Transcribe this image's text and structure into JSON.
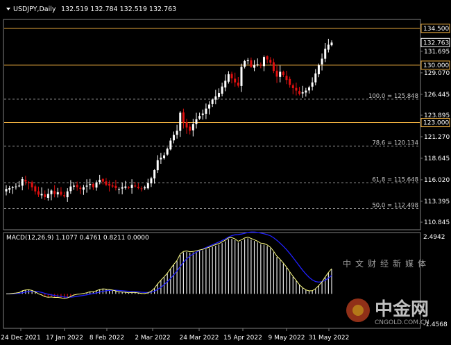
{
  "header": {
    "symbol": "USDJPY,Daily",
    "ohlc": "132.519 132.784 132.519 132.763"
  },
  "indicator": {
    "label": "MACD(12,26,9) 1.1077 0.4761 0.8211 0.0000",
    "scale_top": "2.4942",
    "scale_bottom": "-1.4568"
  },
  "price_scale": [
    "131.695",
    "129.070",
    "126.445",
    "123.895",
    "121.270",
    "118.645",
    "116.020",
    "113.395",
    "110.845"
  ],
  "current_price": "132.763",
  "levels": [
    {
      "value": 134.5,
      "label": "134.500",
      "color": "#f0b040"
    },
    {
      "value": 130.0,
      "label": "130.000",
      "color": "#f0b040"
    },
    {
      "value": 123.0,
      "label": "123.000",
      "color": "#f0b040"
    }
  ],
  "fibo_levels": [
    {
      "value": 125.848,
      "label": "100.0 = 125.848"
    },
    {
      "value": 120.134,
      "label": "78.6 = 120.134"
    },
    {
      "value": 115.648,
      "label": "61.8 = 115.648"
    },
    {
      "value": 112.498,
      "label": "50.0 = 112.498"
    }
  ],
  "date_labels": [
    "24 Dec 2021",
    "17 Jan 2022",
    "8 Feb 2022",
    "2 Mar 2022",
    "24 Mar 2022",
    "15 Apr 2022",
    "9 May 2022",
    "31 May 2022"
  ],
  "watermark": {
    "brand": "中金网",
    "tagline": "中文财经新媒体",
    "site": "CNGOLD.COM.CN"
  },
  "colors": {
    "bull": "#ffffff",
    "bear": "#e01010",
    "macd_line": "#ffff80",
    "signal_line": "#2020ff",
    "grid": "#808080"
  },
  "chart_data": {
    "type": "candlestick",
    "symbol": "USDJPY",
    "timeframe": "Daily",
    "ylim": [
      110.0,
      135.5
    ],
    "closes": [
      114.9,
      115.0,
      115.1,
      115.2,
      115.3,
      116.1,
      115.8,
      115.6,
      115.1,
      114.6,
      114.2,
      114.3,
      113.9,
      114.3,
      114.7,
      114.3,
      114.5,
      114.2,
      114.0,
      114.6,
      115.2,
      115.3,
      115.1,
      114.9,
      115.1,
      115.3,
      115.5,
      115.1,
      115.7,
      116.0,
      115.8,
      115.4,
      115.3,
      115.2,
      115.0,
      114.9,
      115.1,
      115.2,
      115.0,
      115.4,
      115.2,
      115.0,
      114.9,
      115.1,
      115.6,
      116.2,
      117.2,
      118.4,
      118.7,
      119.0,
      119.8,
      120.8,
      121.5,
      122.0,
      124.2,
      123.0,
      122.4,
      122.0,
      122.8,
      123.4,
      123.8,
      124.1,
      124.7,
      125.2,
      125.8,
      126.2,
      126.6,
      127.4,
      128.1,
      128.9,
      128.4,
      127.9,
      127.5,
      129.8,
      130.5,
      130.6,
      129.8,
      130.0,
      130.1,
      130.0,
      131.0,
      130.7,
      130.3,
      129.3,
      128.6,
      129.2,
      128.8,
      128.2,
      127.6,
      127.2,
      126.9,
      126.5,
      126.7,
      126.9,
      127.3,
      127.9,
      129.0,
      130.0,
      130.8,
      132.0,
      132.5,
      132.763
    ],
    "levels": [
      134.5,
      130.0,
      123.0
    ],
    "fibonacci": [
      {
        "ratio": 100.0,
        "price": 125.848
      },
      {
        "ratio": 78.6,
        "price": 120.134
      },
      {
        "ratio": 61.8,
        "price": 115.648
      },
      {
        "ratio": 50.0,
        "price": 112.498
      }
    ],
    "macd": {
      "params": [
        12,
        26,
        9
      ],
      "values": [
        1.1077,
        0.4761,
        0.8211,
        0.0
      ],
      "ylim": [
        -1.4568,
        2.4942
      ]
    }
  }
}
